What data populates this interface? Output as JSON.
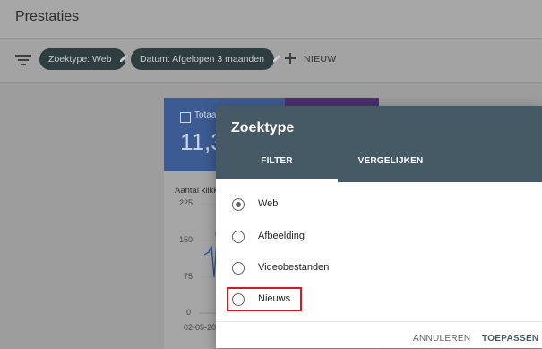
{
  "header": {
    "title": "Prestaties"
  },
  "filters": {
    "chips": [
      {
        "label": "Zoektype: Web"
      },
      {
        "label": "Datum: Afgelopen 3 maanden"
      }
    ],
    "new_label": "NIEUW"
  },
  "background_card": {
    "metric_label": "Totaal",
    "metric_value": "11,3",
    "chart_title": "Aantal klikk",
    "y_ticks": [
      "225",
      "150",
      "75",
      "0"
    ],
    "x_tick": "02-05-20"
  },
  "dialog": {
    "title": "Zoektype",
    "tabs": [
      {
        "label": "FILTER",
        "active": true
      },
      {
        "label": "VERGELIJKEN",
        "active": false
      }
    ],
    "options": [
      {
        "label": "Web",
        "selected": true
      },
      {
        "label": "Afbeelding",
        "selected": false
      },
      {
        "label": "Videobestanden",
        "selected": false
      },
      {
        "label": "Nieuws",
        "selected": false,
        "highlighted": true
      }
    ],
    "cancel_label": "ANNULEREN",
    "apply_label": "TOEPASSEN"
  },
  "colors": {
    "dialog_header": "#455a64",
    "chip_bg": "#2e3d40",
    "highlight_border": "#e0141e",
    "metric_blue": "#3d5b93",
    "metric_purple": "#4b2f72"
  }
}
